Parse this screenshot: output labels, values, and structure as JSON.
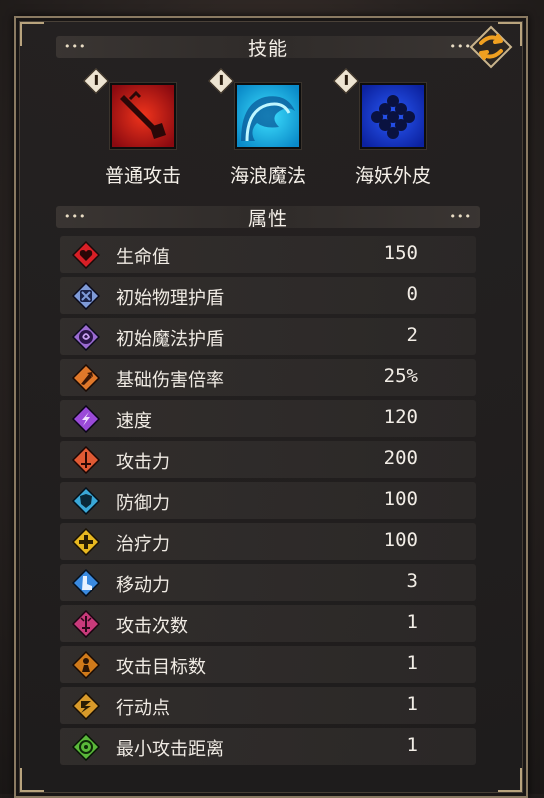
{
  "sections": {
    "skills_title": "技能",
    "attributes_title": "属性",
    "dots": "•••"
  },
  "skills": [
    {
      "name": "普通攻击",
      "icon": "sword-strike-icon",
      "color": "#c8121a"
    },
    {
      "name": "海浪魔法",
      "icon": "wave-magic-icon",
      "color": "#19b8e8"
    },
    {
      "name": "海妖外皮",
      "icon": "siren-scales-icon",
      "color": "#1b3fe0"
    }
  ],
  "stats": [
    {
      "label": "生命值",
      "value": "150",
      "icon": "heart-icon",
      "color": "#d81f26"
    },
    {
      "label": "初始物理护盾",
      "value": "0",
      "icon": "physical-shield-icon",
      "color": "#7e9ad8"
    },
    {
      "label": "初始魔法护盾",
      "value": "2",
      "icon": "magic-shield-icon",
      "color": "#9a6ad0"
    },
    {
      "label": "基础伤害倍率",
      "value": "25%",
      "icon": "damage-multiplier-icon",
      "color": "#e0782a"
    },
    {
      "label": "速度",
      "value": "120",
      "icon": "speed-icon",
      "color": "#9a4ad8"
    },
    {
      "label": "攻击力",
      "value": "200",
      "icon": "attack-icon",
      "color": "#e05a34"
    },
    {
      "label": "防御力",
      "value": "100",
      "icon": "defense-icon",
      "color": "#3aa8d8"
    },
    {
      "label": "治疗力",
      "value": "100",
      "icon": "heal-icon",
      "color": "#e8b820"
    },
    {
      "label": "移动力",
      "value": "3",
      "icon": "move-icon",
      "color": "#3a8ae0"
    },
    {
      "label": "攻击次数",
      "value": "1",
      "icon": "attack-count-icon",
      "color": "#c83a7a"
    },
    {
      "label": "攻击目标数",
      "value": "1",
      "icon": "target-count-icon",
      "color": "#d07a1a"
    },
    {
      "label": "行动点",
      "value": "1",
      "icon": "action-point-icon",
      "color": "#d89a2a"
    },
    {
      "label": "最小攻击距离",
      "value": "1",
      "icon": "min-range-icon",
      "color": "#5ab83a"
    }
  ]
}
